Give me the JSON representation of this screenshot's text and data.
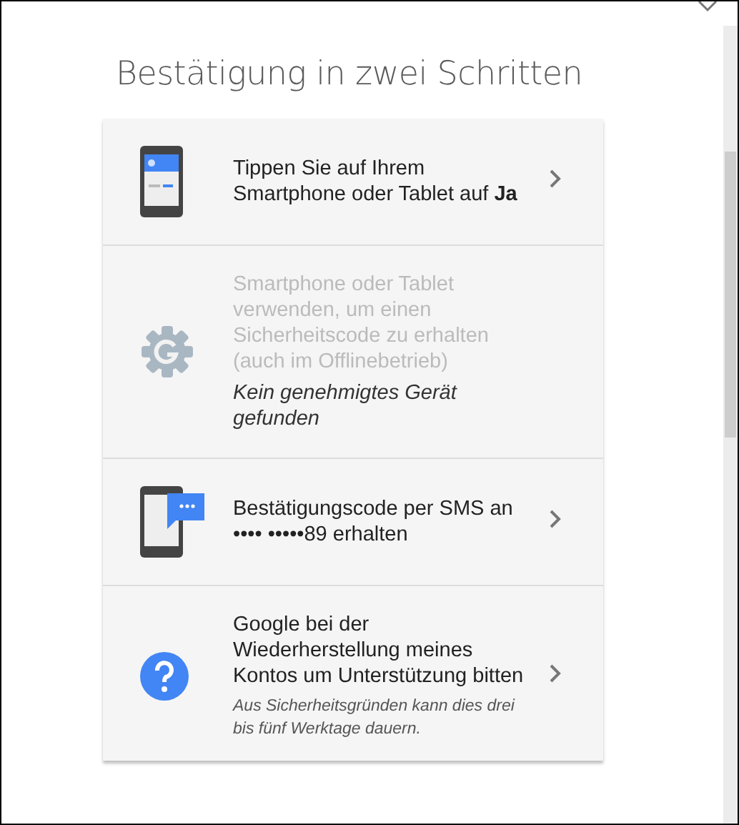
{
  "title": "Bestätigung in zwei Schritten",
  "options": [
    {
      "kind": "phone-prompt",
      "text": "Tippen Sie auf Ihrem Smartphone oder Tablet auf **Ja**",
      "disabled": false,
      "chevron": true
    },
    {
      "kind": "offline-code",
      "text": "Smartphone oder Tablet verwenden, um einen Sicherheitscode zu erhalten (auch im Offlinebetrieb)",
      "note": "Kein genehmigtes Gerät gefunden",
      "disabled": true,
      "chevron": false
    },
    {
      "kind": "sms",
      "text": "Bestätigungscode per SMS an •••• •••••89 erhalten",
      "disabled": false,
      "chevron": true
    },
    {
      "kind": "help",
      "text": "Google bei der Wiederherstellung meines Kontos um Unterstützung bitten",
      "small_note": "Aus Sicherheitsgründen kann dies drei bis fünf Werktage dauern.",
      "disabled": false,
      "chevron": true
    }
  ]
}
